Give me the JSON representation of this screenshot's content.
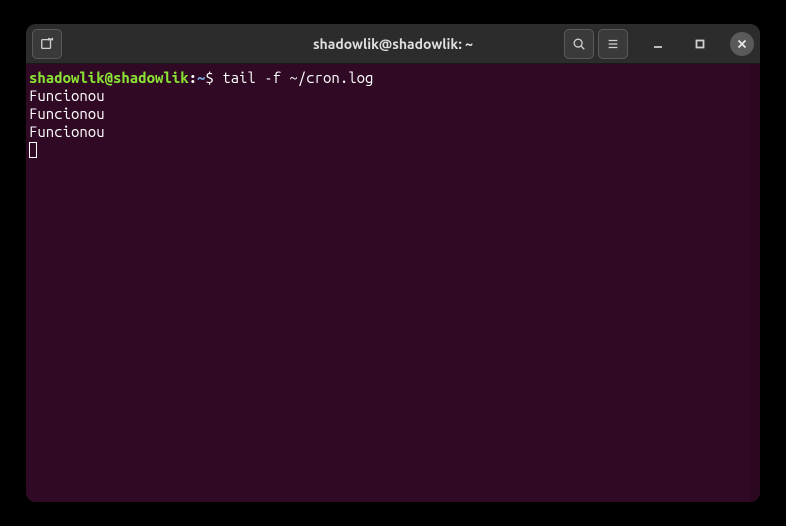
{
  "titlebar": {
    "title": "shadowlik@shadowlik: ~"
  },
  "prompt": {
    "user_host": "shadowlik@shadowlik",
    "colon": ":",
    "path": "~",
    "dollar": "$",
    "command": " tail -f ~/cron.log"
  },
  "output": [
    "Funcionou",
    "Funcionou",
    "Funcionou"
  ]
}
